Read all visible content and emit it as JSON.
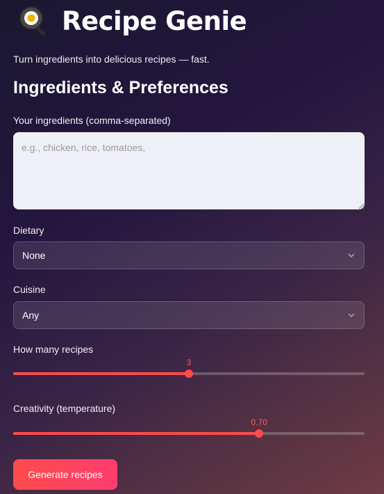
{
  "app": {
    "title": "Recipe Genie",
    "subtitle": "Turn ingredients into delicious recipes — fast.",
    "icon": "frying-pan-egg-icon"
  },
  "section": {
    "heading": "Ingredients & Preferences"
  },
  "ingredients": {
    "label": "Your ingredients (comma-separated)",
    "placeholder": "e.g., chicken, rice, tomatoes,",
    "value": ""
  },
  "dietary": {
    "label": "Dietary",
    "selected": "None"
  },
  "cuisine": {
    "label": "Cuisine",
    "selected": "Any"
  },
  "num_recipes": {
    "label": "How many recipes",
    "value_text": "3",
    "fraction": 0.5
  },
  "creativity": {
    "label": "Creativity (temperature)",
    "value_text": "0.70",
    "fraction": 0.7
  },
  "actions": {
    "generate_label": "Generate recipes"
  },
  "colors": {
    "accent": "#ff4b4b",
    "accent_end": "#ff3d6f"
  }
}
